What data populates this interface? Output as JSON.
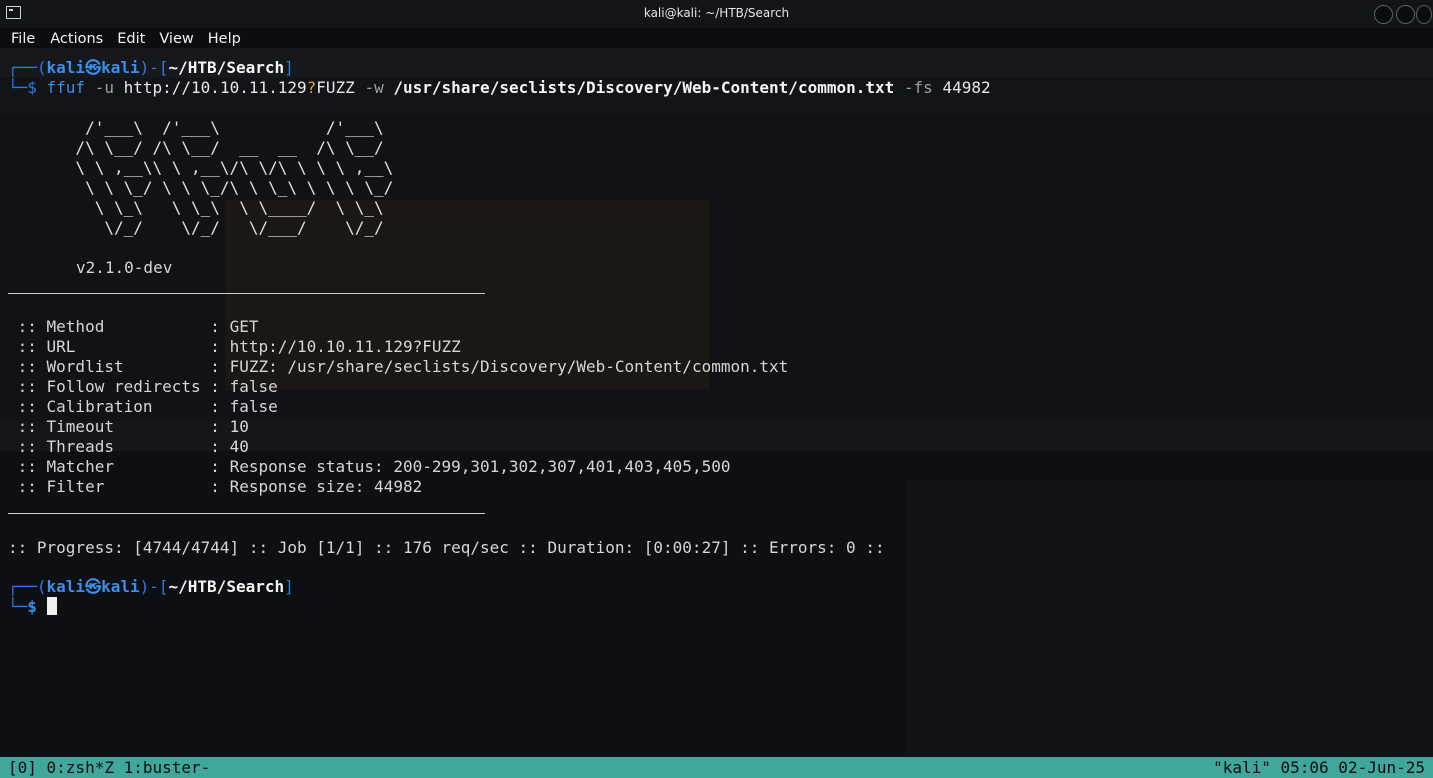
{
  "window": {
    "title": "kali@kali: ~/HTB/Search"
  },
  "menu": [
    "File",
    "Actions",
    "Edit",
    "View",
    "Help"
  ],
  "prompt1": {
    "user": "kali",
    "at_symbol": "㉿",
    "host": "kali",
    "path": "~/HTB/Search",
    "command": "ffuf",
    "opt_u": "-u",
    "url": "http://10.10.11.129",
    "url_q": "?",
    "url_fuzz": "FUZZ",
    "opt_w": "-w",
    "wordlist": "/usr/share/seclists/Discovery/Web-Content/common.txt",
    "opt_fs": "-fs",
    "fs_value": "44982"
  },
  "banner": {
    "ascii": [
      "        /'___\\  /'___\\           /'___\\       ",
      "       /\\ \\__/ /\\ \\__/  __  __  /\\ \\__/       ",
      "       \\ \\ ,__\\\\ \\ ,__\\/\\ \\/\\ \\ \\ \\ ,__\\      ",
      "        \\ \\ \\_/ \\ \\ \\_/\\ \\ \\_\\ \\ \\ \\ \\_/      ",
      "         \\ \\_\\   \\ \\_\\  \\ \\____/  \\ \\_\\       ",
      "          \\/_/    \\/_/   \\/___/    \\/_/       "
    ],
    "version": "v2.1.0-dev"
  },
  "config": [
    {
      "key": "Method",
      "value": "GET"
    },
    {
      "key": "URL",
      "value": "http://10.10.11.129?FUZZ"
    },
    {
      "key": "Wordlist",
      "value": "FUZZ: /usr/share/seclists/Discovery/Web-Content/common.txt"
    },
    {
      "key": "Follow redirects",
      "value": "false"
    },
    {
      "key": "Calibration",
      "value": "false"
    },
    {
      "key": "Timeout",
      "value": "10"
    },
    {
      "key": "Threads",
      "value": "40"
    },
    {
      "key": "Matcher",
      "value": "Response status: 200-299,301,302,307,401,403,405,500"
    },
    {
      "key": "Filter",
      "value": "Response size: 44982"
    }
  ],
  "progress_line": ":: Progress: [4744/4744] :: Job [1/1] :: 176 req/sec :: Duration: [0:00:27] :: Errors: 0 ::",
  "prompt2": {
    "user": "kali",
    "at_symbol": "㉿",
    "host": "kali",
    "path": "~/HTB/Search",
    "dollar": "$"
  },
  "tmux": {
    "left": "[0] 0:zsh*Z 1:buster-",
    "right": "\"kali\" 05:06 02-Jun-25"
  },
  "colors": {
    "accent": "#3b8eea",
    "status_bg": "#3fa89b",
    "terminal_bg": "#0b0d10"
  }
}
